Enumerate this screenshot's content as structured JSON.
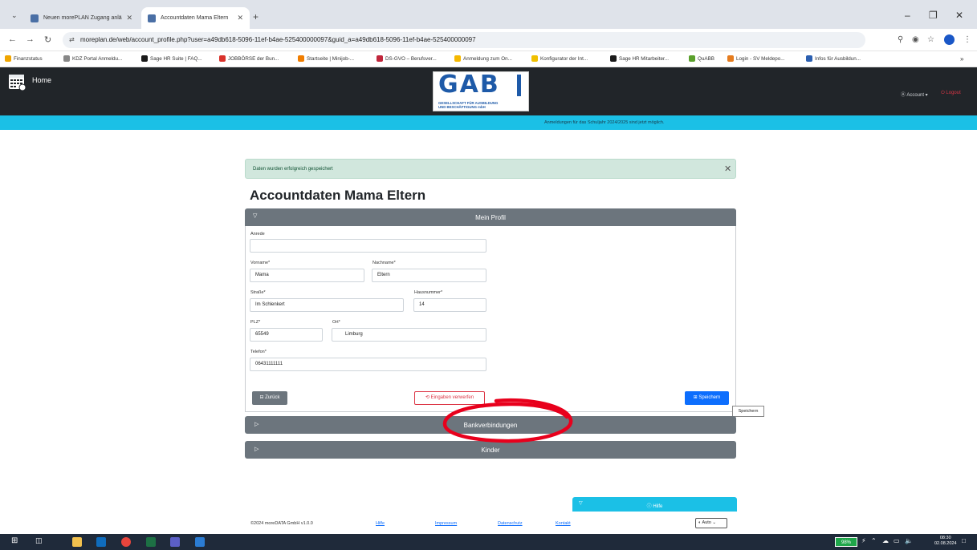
{
  "browser": {
    "tabs": [
      {
        "title": "Neuen morePLAN Zugang anlä",
        "active": false
      },
      {
        "title": "Accountdaten Mama Eltern",
        "active": true
      }
    ],
    "url_site_icon": "site-settings-icon",
    "url": "moreplan.de/web/account_profile.php?user=a49db618-5096-11ef-b4ae-525400000097&guid_a=a49db618-5096-11ef-b4ae-525400000097",
    "bookmarks": [
      {
        "label": "Finanzstatus",
        "color": "#f0a500"
      },
      {
        "label": "KDZ Portal Anmeldu...",
        "color": "#888888"
      },
      {
        "label": "Sage HR Suite | FAQ...",
        "color": "#1a1a1a"
      },
      {
        "label": "JOBBÖRSE der Bun...",
        "color": "#d9322b"
      },
      {
        "label": "Startseite | Minijob-...",
        "color": "#f07d00"
      },
      {
        "label": "DS-GVO – Berufsver...",
        "color": "#c0263b"
      },
      {
        "label": "Anmeldung zum On...",
        "color": "#f5b800"
      },
      {
        "label": "Konfigurator der Int...",
        "color": "#f0c000"
      },
      {
        "label": "Sage HR Mitarbeiter...",
        "color": "#1a1a1a"
      },
      {
        "label": "QuABB",
        "color": "#5aa02c"
      },
      {
        "label": "Login - SV Meldepo...",
        "color": "#e57c1f"
      },
      {
        "label": "Infos für Ausbildun...",
        "color": "#2b5fb0"
      }
    ],
    "bookmarks_more": "»"
  },
  "header": {
    "home_label": "Home",
    "logo_text": "GAB",
    "logo_sub1": "GESELLSCHAFT FÜR AUSBILDUNG",
    "logo_sub2": "UND BESCHÄFTIGUNG mbH",
    "account_label": "Ⓐ Account ▾",
    "logout_label": "⏻ Logout",
    "notice": "Anmeldungen für das Schuljahr 2024/2025 sind jetzt möglich."
  },
  "alert": {
    "text": "Daten wurden erfolgreich gespeichert",
    "close": "✕"
  },
  "page_title": "Accountdaten Mama Eltern",
  "profile": {
    "header": "Mein Profil",
    "fields": {
      "anrede": {
        "label": "Anrede",
        "value": ""
      },
      "vorname": {
        "label": "Vorname*",
        "value": "Mama"
      },
      "nachname": {
        "label": "Nachname*",
        "value": "Eltern"
      },
      "strasse": {
        "label": "Straße*",
        "value": "Im Schlenkert"
      },
      "hausnummer": {
        "label": "Hausnummer*",
        "value": "14"
      },
      "plz": {
        "label": "PLZ*",
        "value": "65549"
      },
      "ort": {
        "label": "Ort*",
        "value": "Limburg"
      },
      "telefon": {
        "label": "Telefon*",
        "value": "06431111111"
      }
    },
    "buttons": {
      "back": "⊟ Zurück",
      "reset": "⟲ Eingaben verwerfen",
      "save": "⊞ Speichern",
      "save_tooltip": "Speichern"
    }
  },
  "sections": {
    "bank": "Bankverbindungen",
    "kinder": "Kinder"
  },
  "help": {
    "label": "ⓘ Hilfe"
  },
  "footer": {
    "copyright": "©2024 moreDATA GmbH v1.0.0",
    "links": [
      "Hilfe",
      "Impressum",
      "Datenschutz",
      "Kontakt"
    ],
    "theme": "◐ Auto ⌄"
  },
  "taskbar": {
    "battery": "98%",
    "time": "08:30",
    "date": "02.08.2024"
  },
  "colors": {
    "accent": "#1bc0e6",
    "header_bg": "#212529",
    "panel": "#6c757d",
    "primary": "#0d6efd",
    "danger": "#dc3545",
    "success_bg": "#d1e7dd",
    "annotation": "#e8001c"
  }
}
